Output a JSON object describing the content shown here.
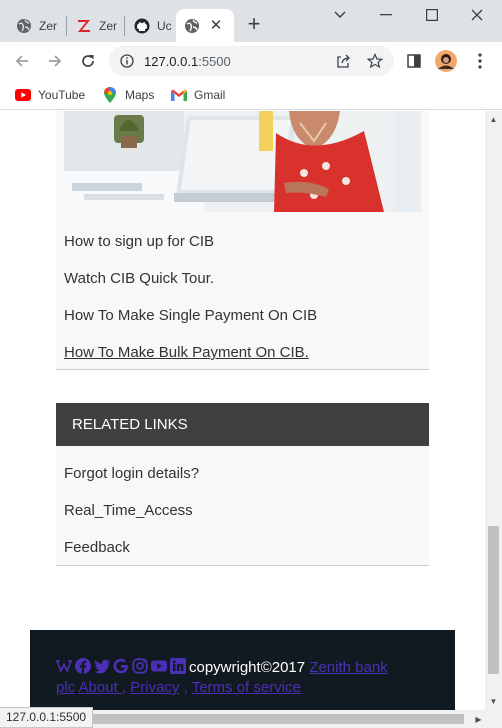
{
  "browser": {
    "tabs": [
      {
        "title": "Zer",
        "icon": "globe-icon"
      },
      {
        "title": "Zer",
        "icon": "zenith-z-icon"
      },
      {
        "title": "Uc",
        "icon": "github-icon"
      },
      {
        "title": "",
        "icon": "globe-icon",
        "active": true
      }
    ],
    "url_host": "127.0.0.1",
    "url_port": ":5500",
    "status_url": "127.0.0.1:5500",
    "bookmarks": [
      {
        "label": "YouTube",
        "icon": "youtube-icon"
      },
      {
        "label": "Maps",
        "icon": "maps-pin-icon"
      },
      {
        "label": "Gmail",
        "icon": "gmail-icon"
      }
    ]
  },
  "cib_links": [
    "How to sign up for CIB",
    "Watch CIB Quick Tour.",
    "How To Make Single Payment On CIB",
    "How To Make Bulk Payment On CIB."
  ],
  "related": {
    "heading": "RELATED LINKS",
    "links": [
      "Forgot login details?",
      "Real_Time_Access",
      "Feedback"
    ]
  },
  "footer": {
    "social_icons": [
      "wikipedia-icon",
      "facebook-icon",
      "twitter-icon",
      "google-icon",
      "instagram-icon",
      "youtube-icon",
      "linkedin-icon"
    ],
    "copyright": "copywright©2017",
    "company_a": "Zenith bank",
    "company_b": "plc",
    "about": "About",
    "privacy": "Privacy",
    "terms": "Terms of service"
  },
  "colors": {
    "footer_bg": "#121a21",
    "footer_link": "#4b2fb5",
    "panel_head": "#404040"
  }
}
